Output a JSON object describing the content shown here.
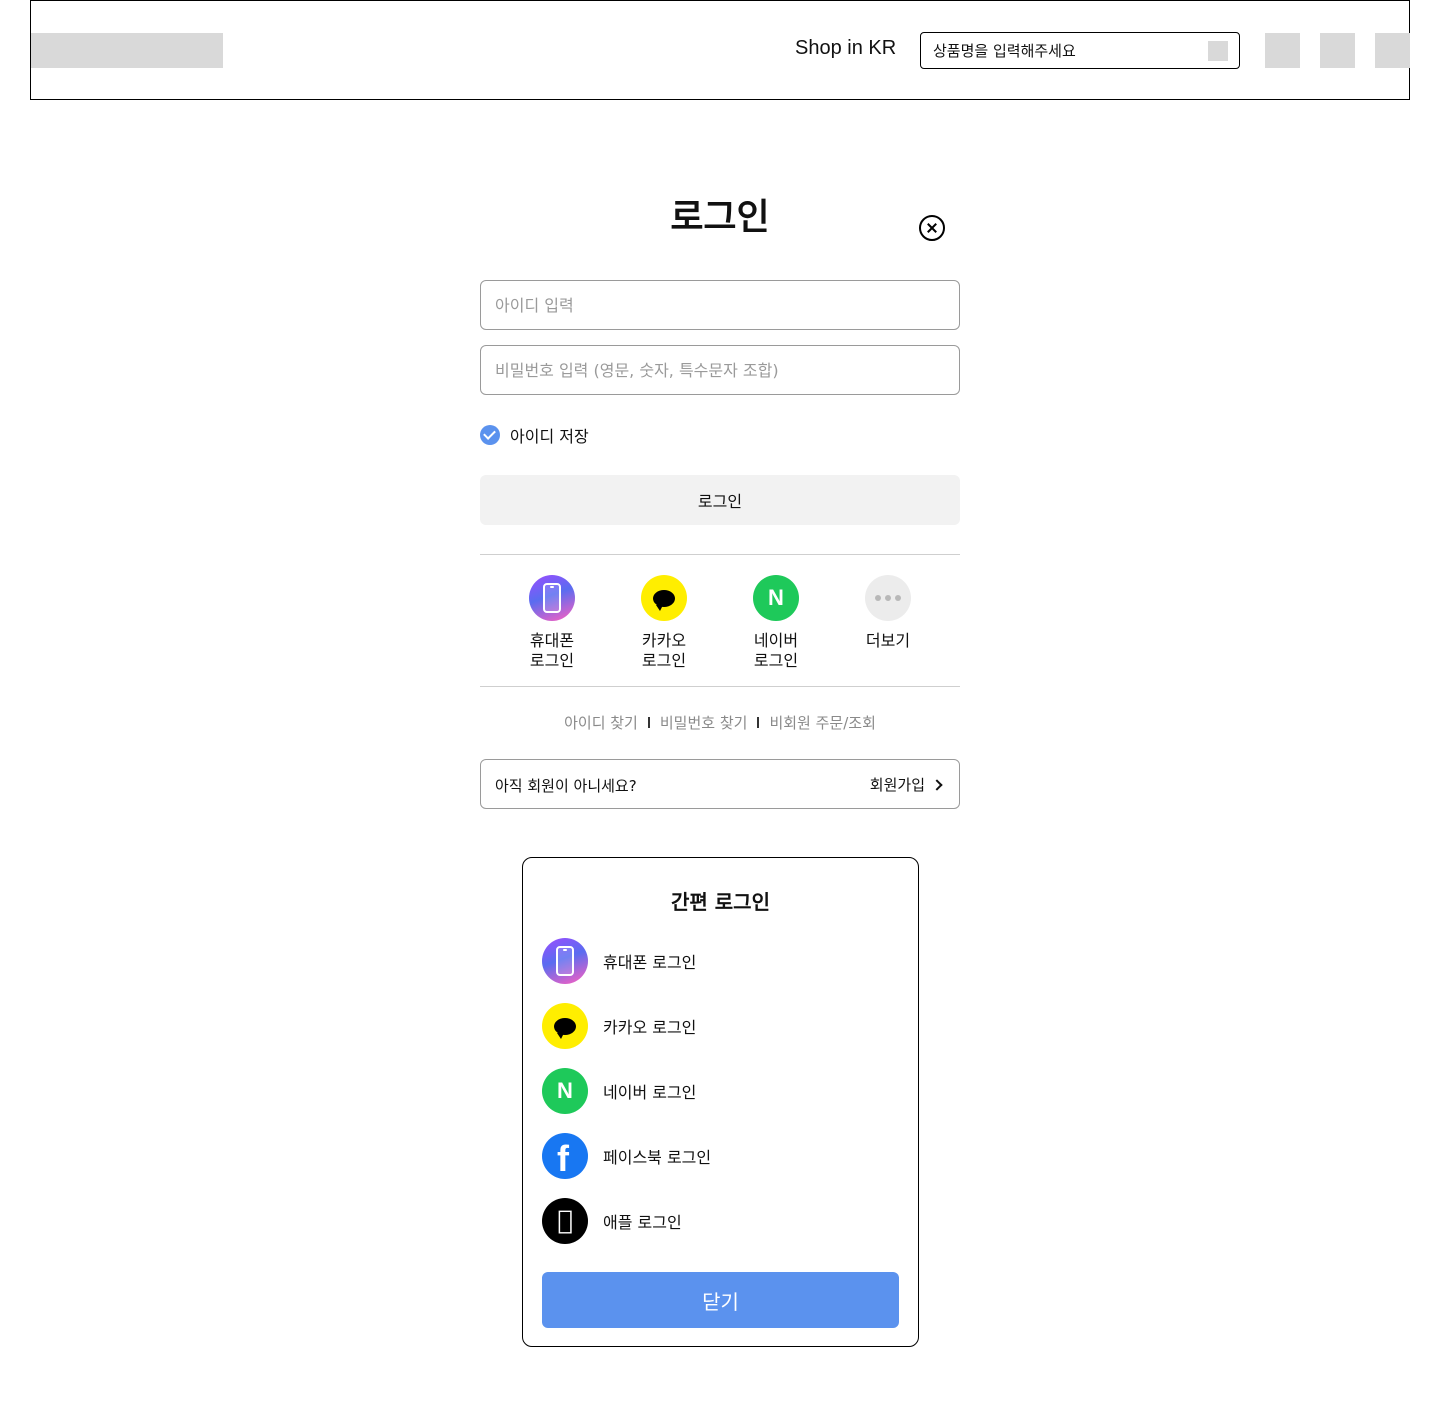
{
  "header": {
    "shop_label": "Shop in KR",
    "search_placeholder": "상품명을 입력해주세요"
  },
  "login": {
    "title": "로그인",
    "id_placeholder": "아이디 입력",
    "password_placeholder": "비밀번호 입력 (영문, 숫자, 특수문자 조합)",
    "remember_label": "아이디 저장",
    "remember_checked": true,
    "login_button": "로그인",
    "sns": [
      {
        "label": "휴대폰\n로그인",
        "icon": "phone-icon"
      },
      {
        "label": "카카오\n로그인",
        "icon": "kakao-icon"
      },
      {
        "label": "네이버\n로그인",
        "icon": "naver-icon",
        "icon_text": "N"
      },
      {
        "label": "더보기",
        "icon": "more-icon"
      }
    ],
    "links": [
      "아이디 찾기",
      "비밀번호 찾기",
      "비회원 주문/조회"
    ],
    "join_question": "아직 회원이 아니세요?",
    "join_link": "회원가입"
  },
  "popup": {
    "title": "간편 로그인",
    "items": [
      {
        "label": "휴대폰 로그인",
        "icon": "phone-icon"
      },
      {
        "label": "카카오 로그인",
        "icon": "kakao-icon"
      },
      {
        "label": "네이버 로그인",
        "icon": "naver-icon",
        "icon_text": "N"
      },
      {
        "label": "페이스북 로그인",
        "icon": "facebook-icon",
        "icon_text": "f"
      },
      {
        "label": "애플 로그인",
        "icon": "apple-icon"
      }
    ],
    "close_button": "닫기"
  },
  "colors": {
    "accent": "#5b92ee",
    "kakao": "#ffee00",
    "naver": "#1ec95a",
    "facebook": "#1877f2",
    "apple": "#000000"
  }
}
